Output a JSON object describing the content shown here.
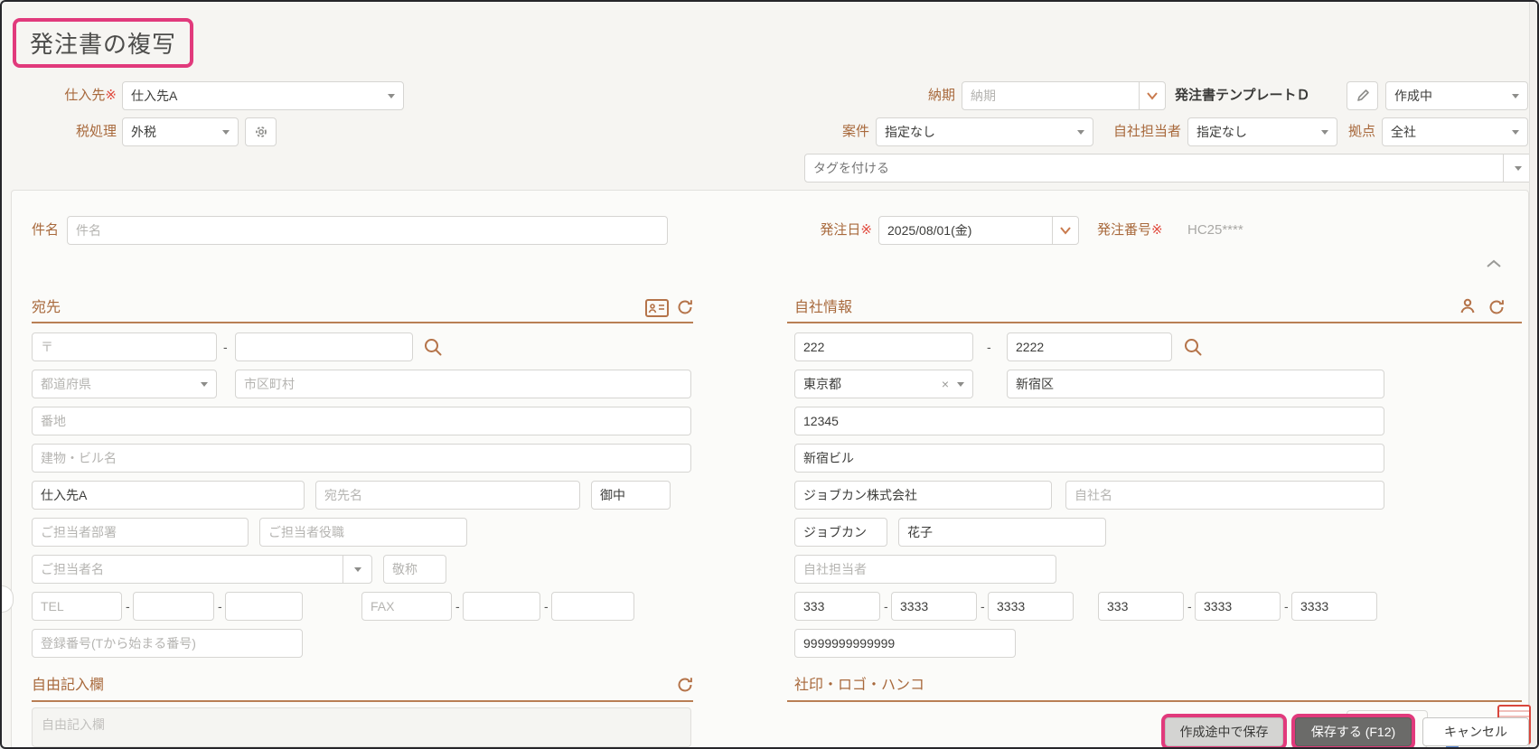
{
  "ui": {
    "dash": "-",
    "clear_glyph": "×"
  },
  "page": {
    "title": "発注書の複写"
  },
  "header": {
    "supplier_label": "仕入先",
    "supplier_required": "※",
    "supplier_value": "仕入先A",
    "tax_label": "税処理",
    "tax_value": "外税",
    "delivery_label": "納期",
    "delivery_placeholder": "納期",
    "template_name": "発注書テンプレートＤ",
    "status_value": "作成中",
    "project_label": "案件",
    "project_value": "指定なし",
    "rep_label": "自社担当者",
    "rep_value": "指定なし",
    "branch_label": "拠点",
    "branch_value": "全社",
    "tag_placeholder": "タグを付ける"
  },
  "order": {
    "subject_label": "件名",
    "subject_placeholder": "件名",
    "date_label": "発注日",
    "date_required": "※",
    "date_value": "2025/08/01(金)",
    "number_label": "発注番号",
    "number_required": "※",
    "number_value": "HC25****"
  },
  "recipient": {
    "title": "宛先",
    "postal_placeholder": "〒",
    "prefecture_placeholder": "都道府県",
    "city_placeholder": "市区町村",
    "street_placeholder": "番地",
    "building_placeholder": "建物・ビル名",
    "company_value": "仕入先A",
    "name_placeholder": "宛先名",
    "honorific_value": "御中",
    "dept_placeholder": "ご担当者部署",
    "role_placeholder": "ご担当者役職",
    "person_placeholder": "ご担当者名",
    "honorific2_placeholder": "敬称",
    "tel_placeholder": "TEL",
    "fax_placeholder": "FAX",
    "reg_placeholder": "登録番号(Tから始まる番号)"
  },
  "company": {
    "title": "自社情報",
    "postal1": "222",
    "postal2": "2222",
    "prefecture": "東京都",
    "city": "新宿区",
    "street": "12345",
    "building": "新宿ビル",
    "name1": "ジョブカン株式会社",
    "name2_placeholder": "自社名",
    "person_last": "ジョブカン",
    "person_first": "花子",
    "rep_placeholder": "自社担当者",
    "tel1": "333",
    "tel2": "3333",
    "tel3": "3333",
    "fax1": "333",
    "fax2": "3333",
    "fax3": "3333",
    "reg_number": "9999999999999"
  },
  "free_entry": {
    "title": "自由記入欄",
    "placeholder": "自由記入欄"
  },
  "stamp_section": {
    "title": "社印・ロゴ・ハンコ"
  },
  "footer": {
    "save_draft": "作成途中で保存",
    "save": "保存する (F12)",
    "cancel": "キャンセル"
  },
  "colors": {
    "accent_pink": "#e13a7c",
    "label_orange": "#a8693c",
    "underline_orange": "#b97f55",
    "icon_orange": "#b5744a",
    "required_red": "#e0483b",
    "save_button_gray": "#6b6b69"
  }
}
